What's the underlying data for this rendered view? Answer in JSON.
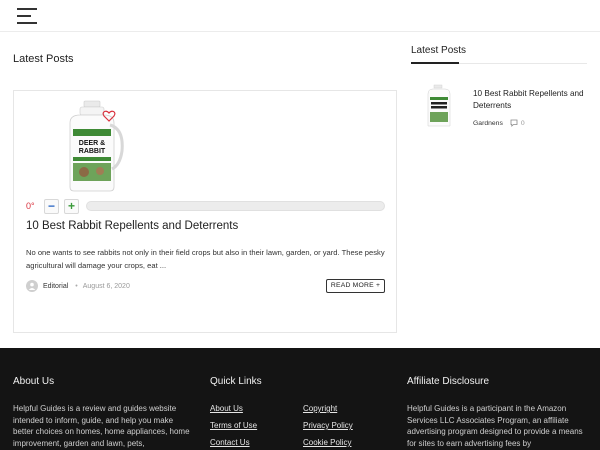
{
  "main": {
    "section_title": "Latest Posts",
    "post": {
      "vote_count": "0°",
      "vote_minus": "−",
      "vote_plus": "+",
      "vote_fraction": 0,
      "title": "10 Best Rabbit Repellents and Deterrents",
      "excerpt": "No one wants to see rabbits not only in their field crops but also in their lawn, garden, or yard. These pesky agricultural will damage your crops, eat ...",
      "author": "Editorial",
      "date": "August 6, 2020",
      "read_more": "READ MORE",
      "product_label_top": "DEER &",
      "product_label_bottom": "RABBIT"
    }
  },
  "sidebar": {
    "title": "Latest Posts",
    "post": {
      "title": "10 Best Rabbit Repellents and Deterrents",
      "category": "Gardnens",
      "comments": "0"
    }
  },
  "footer": {
    "about_heading": "About Us",
    "about_text": "Helpful Guides is a review and guides website intended to inform, guide, and help you make better choices on homes, home appliances, home improvement, garden and lawn, pets,",
    "quick_links_heading": "Quick Links",
    "links_col1": [
      "About Us",
      "Terms of Use",
      "Contact Us"
    ],
    "links_col2": [
      "Copyright",
      "Privacy Policy",
      "Cookie Policy"
    ],
    "affiliate_heading": "Affiliate Disclosure",
    "affiliate_text": "Helpful Guides is a participant in the Amazon Services LLC Associates Program, an affiliate advertising program designed to provide a means for sites to earn advertising fees by"
  },
  "colors": {
    "accent_red": "#d9333f",
    "footer_bg": "#141414",
    "product_green": "#3e8a35"
  }
}
